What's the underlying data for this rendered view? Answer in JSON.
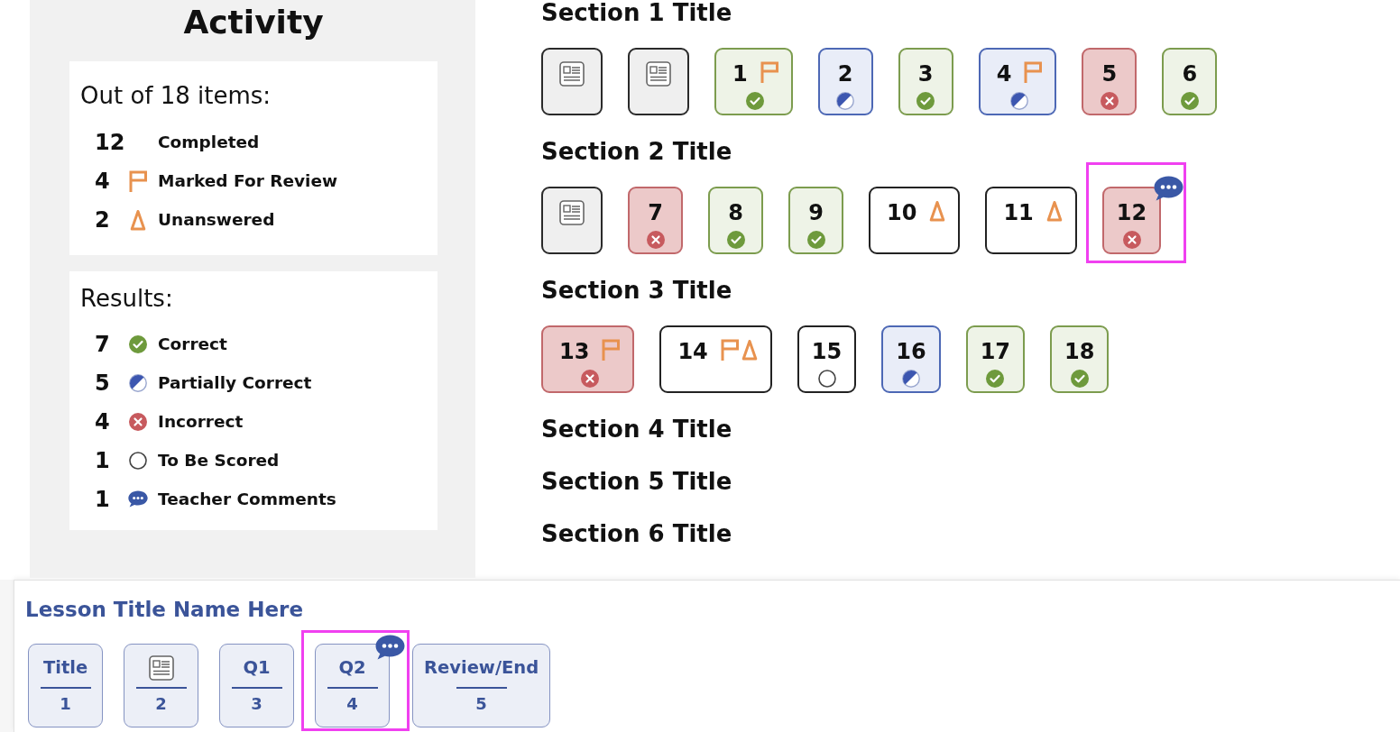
{
  "activity": {
    "title": "Activity",
    "summary": {
      "heading": "Out of 18 items:",
      "rows": [
        {
          "kind": "completed",
          "count": "12",
          "label": "Completed"
        },
        {
          "kind": "flagged",
          "count": "4",
          "label": "Marked For Review"
        },
        {
          "kind": "unanswered",
          "count": "2",
          "label": "Unanswered"
        }
      ]
    },
    "results": {
      "heading": "Results:",
      "rows": [
        {
          "kind": "correct",
          "count": "7",
          "label": "Correct"
        },
        {
          "kind": "partial",
          "count": "5",
          "label": "Partially Correct"
        },
        {
          "kind": "incorrect",
          "count": "4",
          "label": "Incorrect"
        },
        {
          "kind": "to_be_scored",
          "count": "1",
          "label": "To Be Scored"
        },
        {
          "kind": "comment",
          "count": "1",
          "label": "Teacher Comments"
        }
      ]
    }
  },
  "sections": [
    {
      "title": "Section 1 Title",
      "items": [
        {
          "kind": "page",
          "comment": false,
          "highlighted": false
        },
        {
          "kind": "page",
          "comment": false,
          "highlighted": false
        },
        {
          "kind": "correct",
          "number": "1",
          "flagged": true,
          "comment": false,
          "highlighted": false
        },
        {
          "kind": "partial",
          "number": "2",
          "flagged": false,
          "comment": false,
          "highlighted": false
        },
        {
          "kind": "correct",
          "number": "3",
          "flagged": false,
          "comment": false,
          "highlighted": false
        },
        {
          "kind": "partial",
          "number": "4",
          "flagged": true,
          "comment": false,
          "highlighted": false
        },
        {
          "kind": "incorrect",
          "number": "5",
          "flagged": false,
          "comment": false,
          "highlighted": false
        },
        {
          "kind": "correct",
          "number": "6",
          "flagged": false,
          "comment": false,
          "highlighted": false
        }
      ]
    },
    {
      "title": "Section 2 Title",
      "items": [
        {
          "kind": "page",
          "comment": false,
          "highlighted": false
        },
        {
          "kind": "incorrect",
          "number": "7",
          "flagged": false,
          "comment": false,
          "highlighted": false
        },
        {
          "kind": "correct",
          "number": "8",
          "flagged": false,
          "comment": false,
          "highlighted": false
        },
        {
          "kind": "correct",
          "number": "9",
          "flagged": false,
          "comment": false,
          "highlighted": false
        },
        {
          "kind": "unanswered",
          "number": "10",
          "flagged": false,
          "comment": false,
          "highlighted": false
        },
        {
          "kind": "unanswered",
          "number": "11",
          "flagged": false,
          "comment": false,
          "highlighted": false
        },
        {
          "kind": "incorrect",
          "number": "12",
          "flagged": false,
          "comment": true,
          "highlighted": true
        }
      ]
    },
    {
      "title": "Section 3 Title",
      "items": [
        {
          "kind": "incorrect",
          "number": "13",
          "flagged": true,
          "comment": false,
          "highlighted": false
        },
        {
          "kind": "unanswered",
          "number": "14",
          "flagged": true,
          "comment": false,
          "highlighted": false
        },
        {
          "kind": "to_be_scored",
          "number": "15",
          "flagged": false,
          "comment": false,
          "highlighted": false
        },
        {
          "kind": "partial",
          "number": "16",
          "flagged": false,
          "comment": false,
          "highlighted": false
        },
        {
          "kind": "correct",
          "number": "17",
          "flagged": false,
          "comment": false,
          "highlighted": false
        },
        {
          "kind": "correct",
          "number": "18",
          "flagged": false,
          "comment": false,
          "highlighted": false
        }
      ]
    },
    {
      "title": "Section 4 Title"
    },
    {
      "title": "Section 5 Title"
    },
    {
      "title": "Section 6 Title"
    }
  ],
  "lesson_bar": {
    "title": "Lesson Title Name Here",
    "steps": [
      {
        "kind": "text",
        "label": "Title",
        "number": "1",
        "comment": false,
        "highlighted": false
      },
      {
        "kind": "page",
        "number": "2",
        "comment": false,
        "highlighted": false
      },
      {
        "kind": "text",
        "label": "Q1",
        "number": "3",
        "comment": false,
        "highlighted": false
      },
      {
        "kind": "text",
        "label": "Q2",
        "number": "4",
        "comment": true,
        "highlighted": true
      },
      {
        "kind": "text",
        "label": "Review/End",
        "number": "5",
        "comment": false,
        "highlighted": false
      }
    ]
  }
}
